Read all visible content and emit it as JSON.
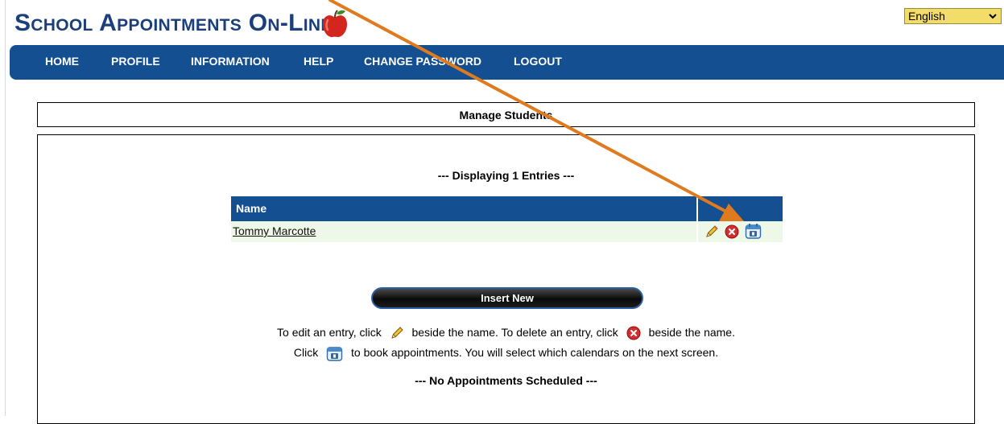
{
  "app": {
    "logo_text": "School Appointments On-Line",
    "language": "English"
  },
  "nav": {
    "items": [
      "HOME",
      "PROFILE",
      "INFORMATION",
      "HELP",
      "CHANGE PASSWORD",
      "LOGOUT"
    ]
  },
  "panel": {
    "title": "Manage Students",
    "display_count": "--- Displaying 1 Entries ---",
    "table": {
      "header_name": "Name",
      "rows": [
        {
          "name": "Tommy Marcotte"
        }
      ]
    },
    "insert_label": "Insert New",
    "help": {
      "edit_prefix": "To edit an entry, click",
      "edit_suffix": "beside the name. To delete an entry, click",
      "delete_suffix": "beside the name.",
      "book_prefix": "Click",
      "book_suffix": "to book appointments. You will select which calendars on the next screen."
    },
    "no_appointments": "--- No Appointments Scheduled ---"
  },
  "colors": {
    "brand_blue": "#134f91",
    "logo_text": "#1a3f7a",
    "language_bg": "#f3dd6a",
    "row_bg": "#eef8e8",
    "annotation_arrow": "#e07a1f"
  },
  "icons": [
    "apple-logo-icon",
    "chevron-down-icon",
    "pencil-edit-icon",
    "delete-x-icon",
    "calendar-book-icon"
  ]
}
